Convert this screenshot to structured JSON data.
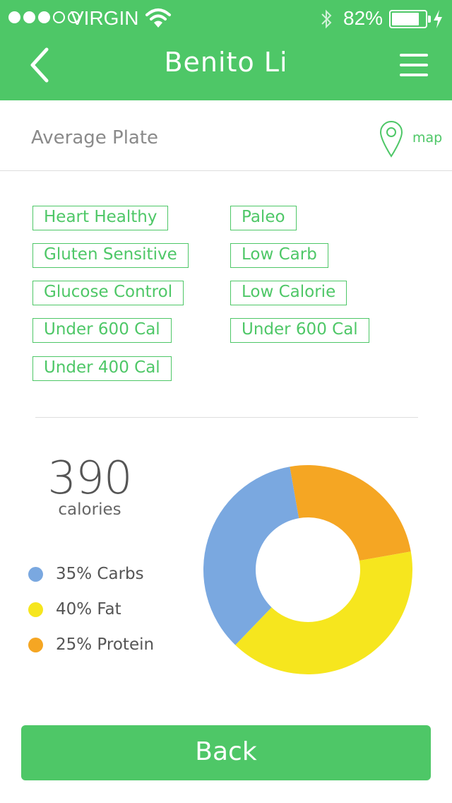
{
  "status_bar": {
    "carrier": "VIRGIN",
    "signal_bars_filled": 3,
    "signal_bars_total": 5,
    "battery_percent": "82%",
    "battery_level": 0.82,
    "icons": [
      "wifi-icon",
      "bluetooth-icon",
      "battery-icon",
      "charging-bolt-icon"
    ]
  },
  "nav": {
    "title": "Benito Li",
    "back_icon": "chevron-left-icon",
    "menu_icon": "hamburger-menu-icon"
  },
  "plate": {
    "title": "Average Plate",
    "map_label": "map",
    "map_icon": "map-pin-icon"
  },
  "tags": {
    "left": [
      "Heart Healthy",
      "Gluten Sensitive",
      "Glucose Control",
      "Under 600 Cal",
      "Under 400 Cal"
    ],
    "right": [
      "Paleo",
      "Low Carb",
      "Low Calorie",
      "Under 600 Cal"
    ]
  },
  "nutrition": {
    "calories": "390",
    "calories_label": "calories",
    "legend": [
      {
        "label": "35% Carbs",
        "color": "#7aa8e0"
      },
      {
        "label": "40% Fat",
        "color": "#f6e61e"
      },
      {
        "label": "25% Protein",
        "color": "#f5a623"
      }
    ]
  },
  "chart_data": {
    "type": "pie",
    "categories": [
      "Carbs",
      "Fat",
      "Protein"
    ],
    "values": [
      35,
      40,
      25
    ],
    "colors": [
      "#7aa8e0",
      "#f6e61e",
      "#f5a623"
    ],
    "donut": true
  },
  "actions": {
    "back_label": "Back"
  },
  "colors": {
    "accent": "#4ec767",
    "muted_text": "#8a8a8a"
  }
}
